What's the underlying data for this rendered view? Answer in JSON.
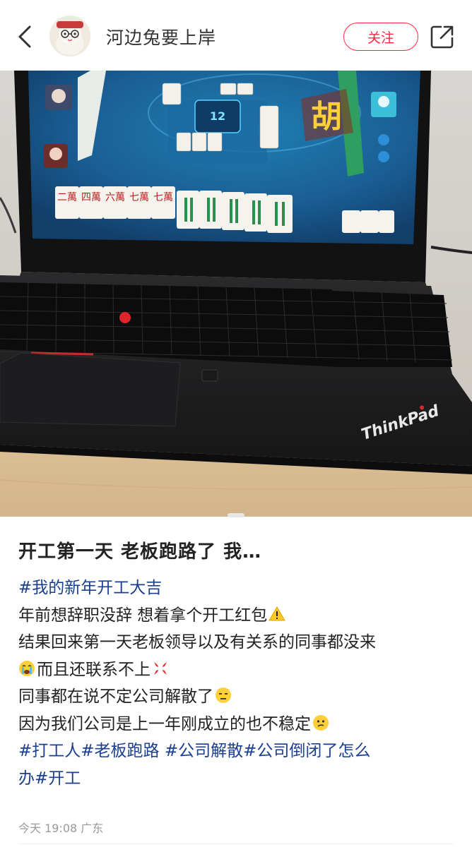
{
  "header": {
    "username": "河边兔要上岸",
    "follow_label": "关注",
    "icons": [
      "back-arrow-icon",
      "share-icon"
    ]
  },
  "photo": {
    "laptop_brand": "ThinkPad",
    "win_tile": "胡",
    "counter": "12",
    "tiles": [
      "二萬",
      "四萬",
      "六萬",
      "七萬",
      "七萬"
    ]
  },
  "post": {
    "title": "开工第一天 老板跑路了 我…",
    "hashtag_line": "#我的新年开工大吉",
    "line1": "年前想辞职没辞 想着拿个开工红包",
    "line2": "结果回来第一天老板领导以及有关系的同事都没来",
    "line3": "而且还联系不上",
    "line4": "同事都在说不定公司解散了",
    "line5": "因为我们公司是上一年刚成立的也不稳定",
    "tags_line1": "#打工人#老板跑路 #公司解散#公司倒闭了怎么",
    "tags_line2": "办#开工",
    "meta": "今天 19:08 广东"
  },
  "colors": {
    "accent": "#ff2442",
    "hashtag": "#1a3f8e"
  }
}
